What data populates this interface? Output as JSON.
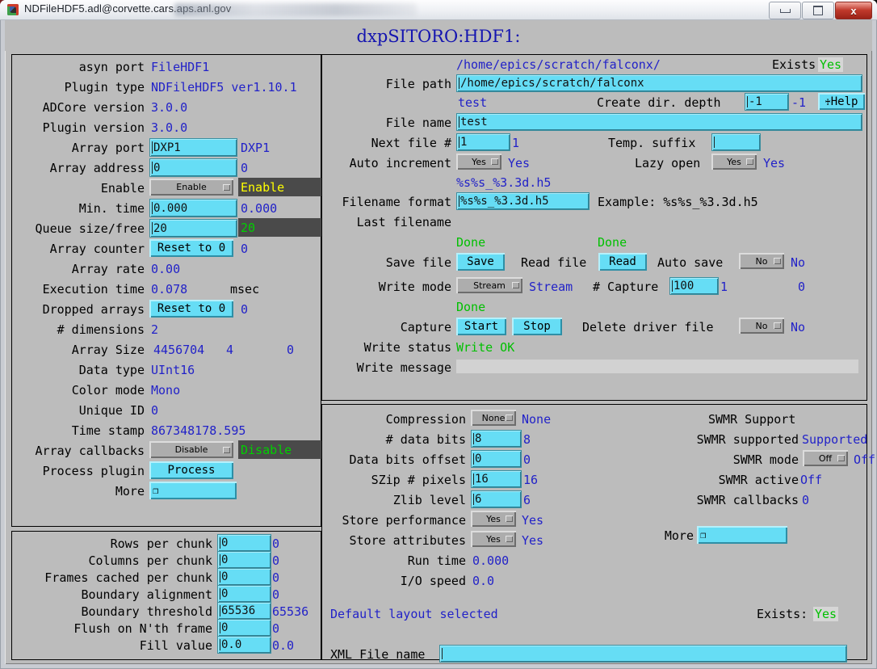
{
  "window": {
    "title": "NDFileHDF5.adl@corvette.cars.aps.anl.gov",
    "minimize_label": "Minimize",
    "maximize_label": "Maximize",
    "close_label": "x"
  },
  "header": {
    "title": "dxpSITORO:HDF1:"
  },
  "plugin_panel": {
    "rows": [
      {
        "label": "asyn port",
        "value": "FileHDF1"
      },
      {
        "label": "Plugin type",
        "value": "NDFileHDF5 ver1.10.1"
      },
      {
        "label": "ADCore version",
        "value": "3.0.0"
      },
      {
        "label": "Plugin version",
        "value": "3.0.0"
      },
      {
        "label": "Array port",
        "input": "DXP1",
        "value": "DXP1"
      },
      {
        "label": "Array address",
        "input": "0",
        "value": "0"
      },
      {
        "label": "Enable",
        "menu": "Enable",
        "readback": "Enable"
      },
      {
        "label": "Min. time",
        "input": "0.000",
        "value": "0.000"
      },
      {
        "label": "Queue size/free",
        "input": "20",
        "readback": "20"
      },
      {
        "label": "Array counter",
        "button": "Reset to 0",
        "value": "0"
      },
      {
        "label": "Array rate",
        "value": "0.00"
      },
      {
        "label": "Execution time",
        "value": "0.078",
        "unit": "msec"
      },
      {
        "label": "Dropped arrays",
        "button": "Reset to 0",
        "value": "0"
      },
      {
        "label": "# dimensions",
        "value": "2"
      },
      {
        "label": "Array Size",
        "value": "4456704",
        "value2": "4",
        "value3": "0"
      },
      {
        "label": "Data type",
        "value": "UInt16"
      },
      {
        "label": "Color mode",
        "value": "Mono"
      },
      {
        "label": "Unique ID",
        "value": "0"
      },
      {
        "label": "Time stamp",
        "value": "867348178.595"
      },
      {
        "label": "Array callbacks",
        "menu": "Disable",
        "readback": "Disable"
      },
      {
        "label": "Process plugin",
        "button": "Process"
      },
      {
        "label": "More",
        "button": "❐"
      }
    ]
  },
  "chunk_panel": {
    "rows": [
      {
        "label": "Rows per chunk",
        "input": "0",
        "value": "0"
      },
      {
        "label": "Columns per chunk",
        "input": "0",
        "value": "0"
      },
      {
        "label": "Frames cached per chunk",
        "input": "0",
        "value": "0"
      },
      {
        "label": "Boundary alignment",
        "input": "0",
        "value": "0"
      },
      {
        "label": "Boundary threshold",
        "input": "65536",
        "value": "65536"
      },
      {
        "label": "Flush on N'th frame",
        "input": "0",
        "value": "0"
      },
      {
        "label": "Fill value",
        "input": "0.0",
        "value": "0.0"
      }
    ]
  },
  "file_panel": {
    "file_path_readback": "/home/epics/scratch/falconx/",
    "exists_label": "Exists:",
    "exists_value": "Yes",
    "file_path_label": "File path",
    "file_path_input": "/home/epics/scratch/falconx",
    "file_name_readback": "test",
    "create_dir_label": "Create dir. depth",
    "create_dir_input": "-1",
    "create_dir_value": "-1",
    "help_button": "Help",
    "file_name_label": "File name",
    "file_name_input": "test",
    "next_file_label": "Next file #",
    "next_file_input": "1",
    "next_file_value": "1",
    "temp_suffix_label": "Temp. suffix",
    "temp_suffix_input": "",
    "auto_increment_label": "Auto increment",
    "auto_increment_menu": "Yes",
    "auto_increment_value": "Yes",
    "lazy_open_label": "Lazy open",
    "lazy_open_menu": "Yes",
    "lazy_open_value": "Yes",
    "filename_format_readback": "%s%s_%3.3d.h5",
    "filename_format_label": "Filename format",
    "filename_format_input": "%s%s_%3.3d.h5",
    "example_label": "Example: %s%s_%3.3d.h5",
    "last_filename_label": "Last filename",
    "save_status": "Done",
    "read_status": "Done",
    "save_file_label": "Save file",
    "save_button": "Save",
    "read_file_label": "Read file",
    "read_button": "Read",
    "auto_save_label": "Auto save",
    "auto_save_menu": "No",
    "auto_save_value": "No",
    "write_mode_label": "Write mode",
    "write_mode_menu": "Stream",
    "write_mode_value": "Stream",
    "num_capture_label": "# Capture",
    "num_capture_input": "100",
    "num_capture_value": "1",
    "num_captured_value": "0",
    "capture_status": "Done",
    "capture_label": "Capture",
    "capture_start_button": "Start",
    "capture_stop_button": "Stop",
    "delete_driver_label": "Delete driver file",
    "delete_driver_menu": "No",
    "delete_driver_value": "No",
    "write_status_label": "Write status",
    "write_status_value": "Write OK",
    "write_message_label": "Write message",
    "write_message_value": ""
  },
  "hdf_panel": {
    "left_rows": [
      {
        "label": "Compression",
        "menu": "None",
        "value": "None"
      },
      {
        "label": "# data bits",
        "input": "8",
        "value": "8"
      },
      {
        "label": "Data bits offset",
        "input": "0",
        "value": "0"
      },
      {
        "label": "SZip # pixels",
        "input": "16",
        "value": "16"
      },
      {
        "label": "Zlib level",
        "input": "6",
        "value": "6"
      },
      {
        "label": "Store performance",
        "menu": "Yes",
        "value": "Yes"
      },
      {
        "label": "Store attributes",
        "menu": "Yes",
        "value": "Yes"
      },
      {
        "label": "Run time",
        "value": "0.000"
      },
      {
        "label": "I/O speed",
        "value": "0.0"
      }
    ],
    "swmr_title": "SWMR Support",
    "swmr_rows": [
      {
        "label": "SWMR supported",
        "value": "Supported"
      },
      {
        "label": "SWMR mode",
        "menu": "Off",
        "value": "Off"
      },
      {
        "label": "SWMR active",
        "value": "Off"
      },
      {
        "label": "SWMR callbacks",
        "value": "0"
      }
    ],
    "more_label": "More",
    "more_button": "❐",
    "layout_status": "Default layout selected",
    "exists_label": "Exists:",
    "exists_value": "Yes",
    "xml_label": "XML File name",
    "xml_input": ""
  },
  "colors": {
    "accent_cyan": "#66ddf5",
    "value_blue": "#2222c8",
    "status_green": "#00c000",
    "panel_grey": "#bcbcbc"
  }
}
